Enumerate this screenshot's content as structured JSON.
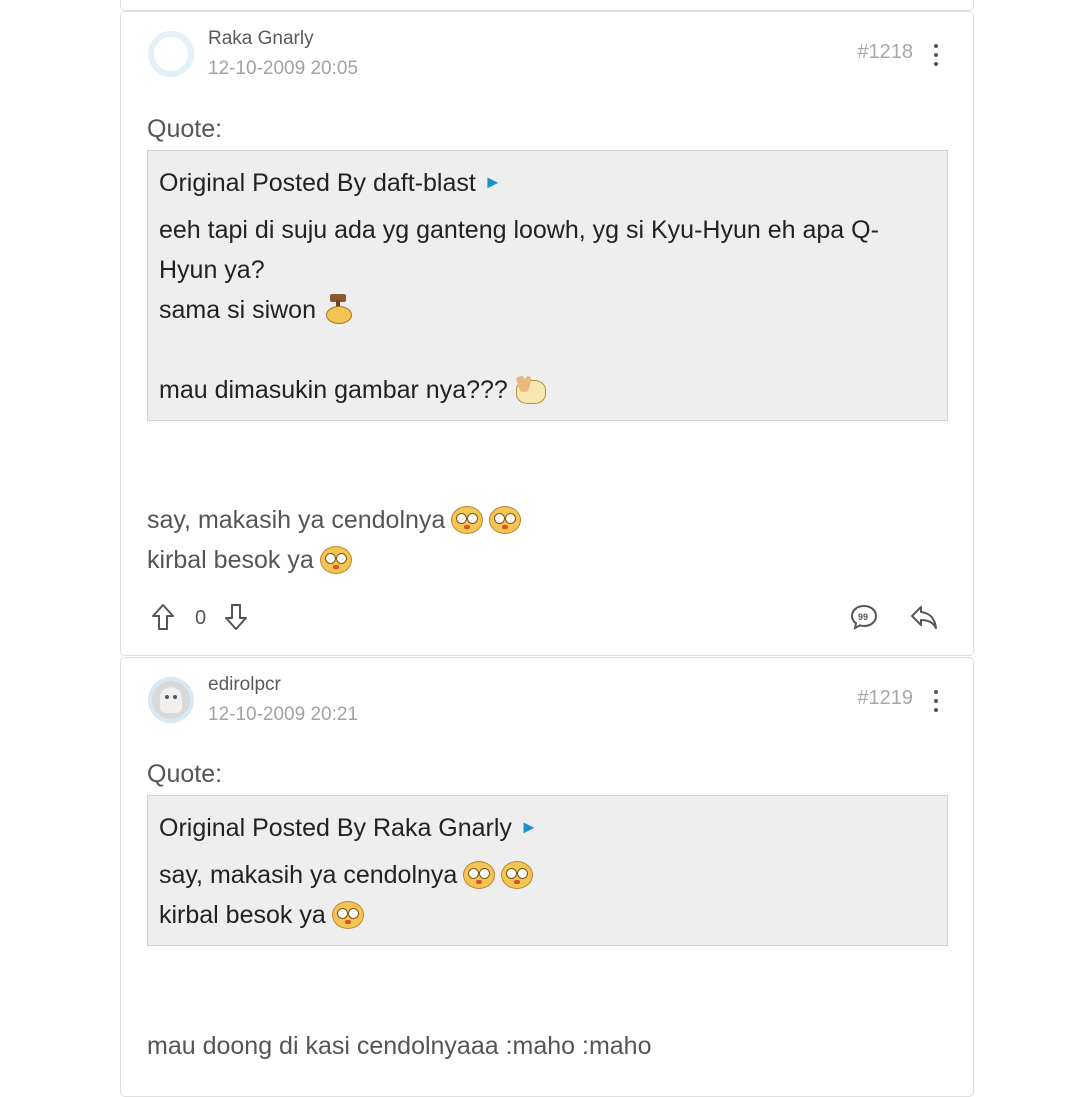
{
  "posts": [
    {
      "username": "Raka Gnarly",
      "timestamp": "12-10-2009 20:05",
      "post_number": "#1218",
      "quote_label": "Quote:",
      "quote_header": "Original Posted By daft-blast",
      "quote_arrow": "►",
      "quote_lines": [
        "eeh tapi di suju ada yg ganteng loowh, yg si Kyu-Hyun eh apa Q-",
        "Hyun ya?",
        "sama si siwon",
        "mau dimasukin gambar nya???"
      ],
      "body_lines": [
        "say, makasih ya cendolnya",
        "kirbal besok ya"
      ],
      "vote_count": "0"
    },
    {
      "username": "edirolpcr",
      "timestamp": "12-10-2009 20:21",
      "post_number": "#1219",
      "quote_label": "Quote:",
      "quote_header": "Original Posted By Raka Gnarly",
      "quote_arrow": "►",
      "quote_lines": [
        "say, makasih ya cendolnya",
        "kirbal besok ya"
      ],
      "body_lines": [
        "mau doong di kasi cendolnyaaa :maho :maho"
      ]
    }
  ],
  "colors": {
    "accent_link": "#1b8fd4",
    "quote_background": "#eeeeee",
    "card_border": "#dedede"
  },
  "icons": [
    "upvote-icon",
    "downvote-icon",
    "quote-reply-icon",
    "reply-icon",
    "more-options-icon",
    "view-original-icon"
  ]
}
